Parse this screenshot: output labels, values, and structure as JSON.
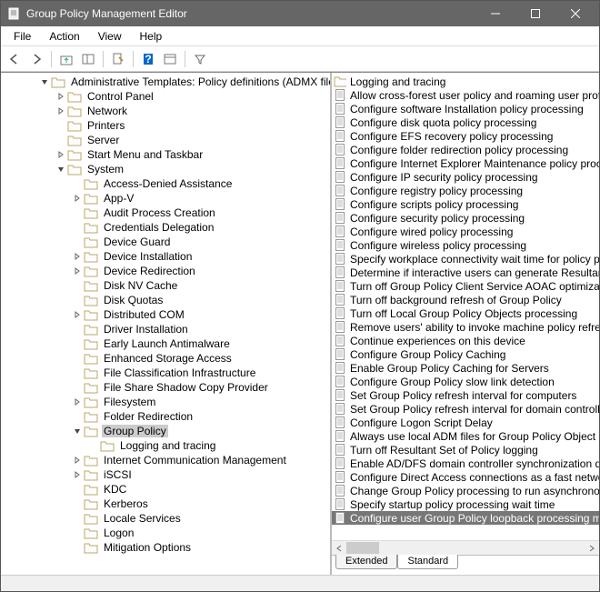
{
  "window": {
    "title": "Group Policy Management Editor"
  },
  "menu": {
    "items": [
      "File",
      "Action",
      "View",
      "Help"
    ]
  },
  "tree": {
    "root": {
      "label": "Administrative Templates: Policy definitions (ADMX files)",
      "expanded": true
    },
    "items": [
      {
        "level": 1,
        "label": "Control Panel",
        "expander": "right"
      },
      {
        "level": 1,
        "label": "Network",
        "expander": "right"
      },
      {
        "level": 1,
        "label": "Printers",
        "expander": ""
      },
      {
        "level": 1,
        "label": "Server",
        "expander": ""
      },
      {
        "level": 1,
        "label": "Start Menu and Taskbar",
        "expander": "right"
      },
      {
        "level": 1,
        "label": "System",
        "expander": "down"
      },
      {
        "level": 2,
        "label": "Access-Denied Assistance",
        "expander": ""
      },
      {
        "level": 2,
        "label": "App-V",
        "expander": "right"
      },
      {
        "level": 2,
        "label": "Audit Process Creation",
        "expander": ""
      },
      {
        "level": 2,
        "label": "Credentials Delegation",
        "expander": ""
      },
      {
        "level": 2,
        "label": "Device Guard",
        "expander": ""
      },
      {
        "level": 2,
        "label": "Device Installation",
        "expander": "right"
      },
      {
        "level": 2,
        "label": "Device Redirection",
        "expander": "right"
      },
      {
        "level": 2,
        "label": "Disk NV Cache",
        "expander": ""
      },
      {
        "level": 2,
        "label": "Disk Quotas",
        "expander": ""
      },
      {
        "level": 2,
        "label": "Distributed COM",
        "expander": "right"
      },
      {
        "level": 2,
        "label": "Driver Installation",
        "expander": ""
      },
      {
        "level": 2,
        "label": "Early Launch Antimalware",
        "expander": ""
      },
      {
        "level": 2,
        "label": "Enhanced Storage Access",
        "expander": ""
      },
      {
        "level": 2,
        "label": "File Classification Infrastructure",
        "expander": ""
      },
      {
        "level": 2,
        "label": "File Share Shadow Copy Provider",
        "expander": ""
      },
      {
        "level": 2,
        "label": "Filesystem",
        "expander": "right"
      },
      {
        "level": 2,
        "label": "Folder Redirection",
        "expander": ""
      },
      {
        "level": 2,
        "label": "Group Policy",
        "expander": "down",
        "selected": true
      },
      {
        "level": 3,
        "label": "Logging and tracing",
        "expander": ""
      },
      {
        "level": 2,
        "label": "Internet Communication Management",
        "expander": "right"
      },
      {
        "level": 2,
        "label": "iSCSI",
        "expander": "right"
      },
      {
        "level": 2,
        "label": "KDC",
        "expander": ""
      },
      {
        "level": 2,
        "label": "Kerberos",
        "expander": ""
      },
      {
        "level": 2,
        "label": "Locale Services",
        "expander": ""
      },
      {
        "level": 2,
        "label": "Logon",
        "expander": ""
      },
      {
        "level": 2,
        "label": "Mitigation Options",
        "expander": ""
      }
    ]
  },
  "list": {
    "items": [
      {
        "type": "folder",
        "label": "Logging and tracing"
      },
      {
        "type": "setting",
        "label": "Allow cross-forest user policy and roaming user profiles"
      },
      {
        "type": "setting",
        "label": "Configure software Installation policy processing"
      },
      {
        "type": "setting",
        "label": "Configure disk quota policy processing"
      },
      {
        "type": "setting",
        "label": "Configure EFS recovery policy processing"
      },
      {
        "type": "setting",
        "label": "Configure folder redirection policy processing"
      },
      {
        "type": "setting",
        "label": "Configure Internet Explorer Maintenance policy processing"
      },
      {
        "type": "setting",
        "label": "Configure IP security policy processing"
      },
      {
        "type": "setting",
        "label": "Configure registry policy processing"
      },
      {
        "type": "setting",
        "label": "Configure scripts policy processing"
      },
      {
        "type": "setting",
        "label": "Configure security policy processing"
      },
      {
        "type": "setting",
        "label": "Configure wired policy processing"
      },
      {
        "type": "setting",
        "label": "Configure wireless policy processing"
      },
      {
        "type": "setting",
        "label": "Specify workplace connectivity wait time for policy processing"
      },
      {
        "type": "setting",
        "label": "Determine if interactive users can generate Resultant Set of Policy"
      },
      {
        "type": "setting",
        "label": "Turn off Group Policy Client Service AOAC optimization"
      },
      {
        "type": "setting",
        "label": "Turn off background refresh of Group Policy"
      },
      {
        "type": "setting",
        "label": "Turn off Local Group Policy Objects processing"
      },
      {
        "type": "setting",
        "label": "Remove users' ability to invoke machine policy refresh"
      },
      {
        "type": "setting",
        "label": "Continue experiences on this device"
      },
      {
        "type": "setting",
        "label": "Configure Group Policy Caching"
      },
      {
        "type": "setting",
        "label": "Enable Group Policy Caching for Servers"
      },
      {
        "type": "setting",
        "label": "Configure Group Policy slow link detection"
      },
      {
        "type": "setting",
        "label": "Set Group Policy refresh interval for computers"
      },
      {
        "type": "setting",
        "label": "Set Group Policy refresh interval for domain controllers"
      },
      {
        "type": "setting",
        "label": "Configure Logon Script Delay"
      },
      {
        "type": "setting",
        "label": "Always use local ADM files for Group Policy Object Editor"
      },
      {
        "type": "setting",
        "label": "Turn off Resultant Set of Policy logging"
      },
      {
        "type": "setting",
        "label": "Enable AD/DFS domain controller synchronization during policy refresh"
      },
      {
        "type": "setting",
        "label": "Configure Direct Access connections as a fast network connection"
      },
      {
        "type": "setting",
        "label": "Change Group Policy processing to run asynchronously when a slow link is detected"
      },
      {
        "type": "setting",
        "label": "Specify startup policy processing wait time"
      },
      {
        "type": "setting",
        "label": "Configure user Group Policy loopback processing mode",
        "selected": true
      }
    ]
  },
  "tabs": {
    "extended": "Extended",
    "standard": "Standard"
  }
}
